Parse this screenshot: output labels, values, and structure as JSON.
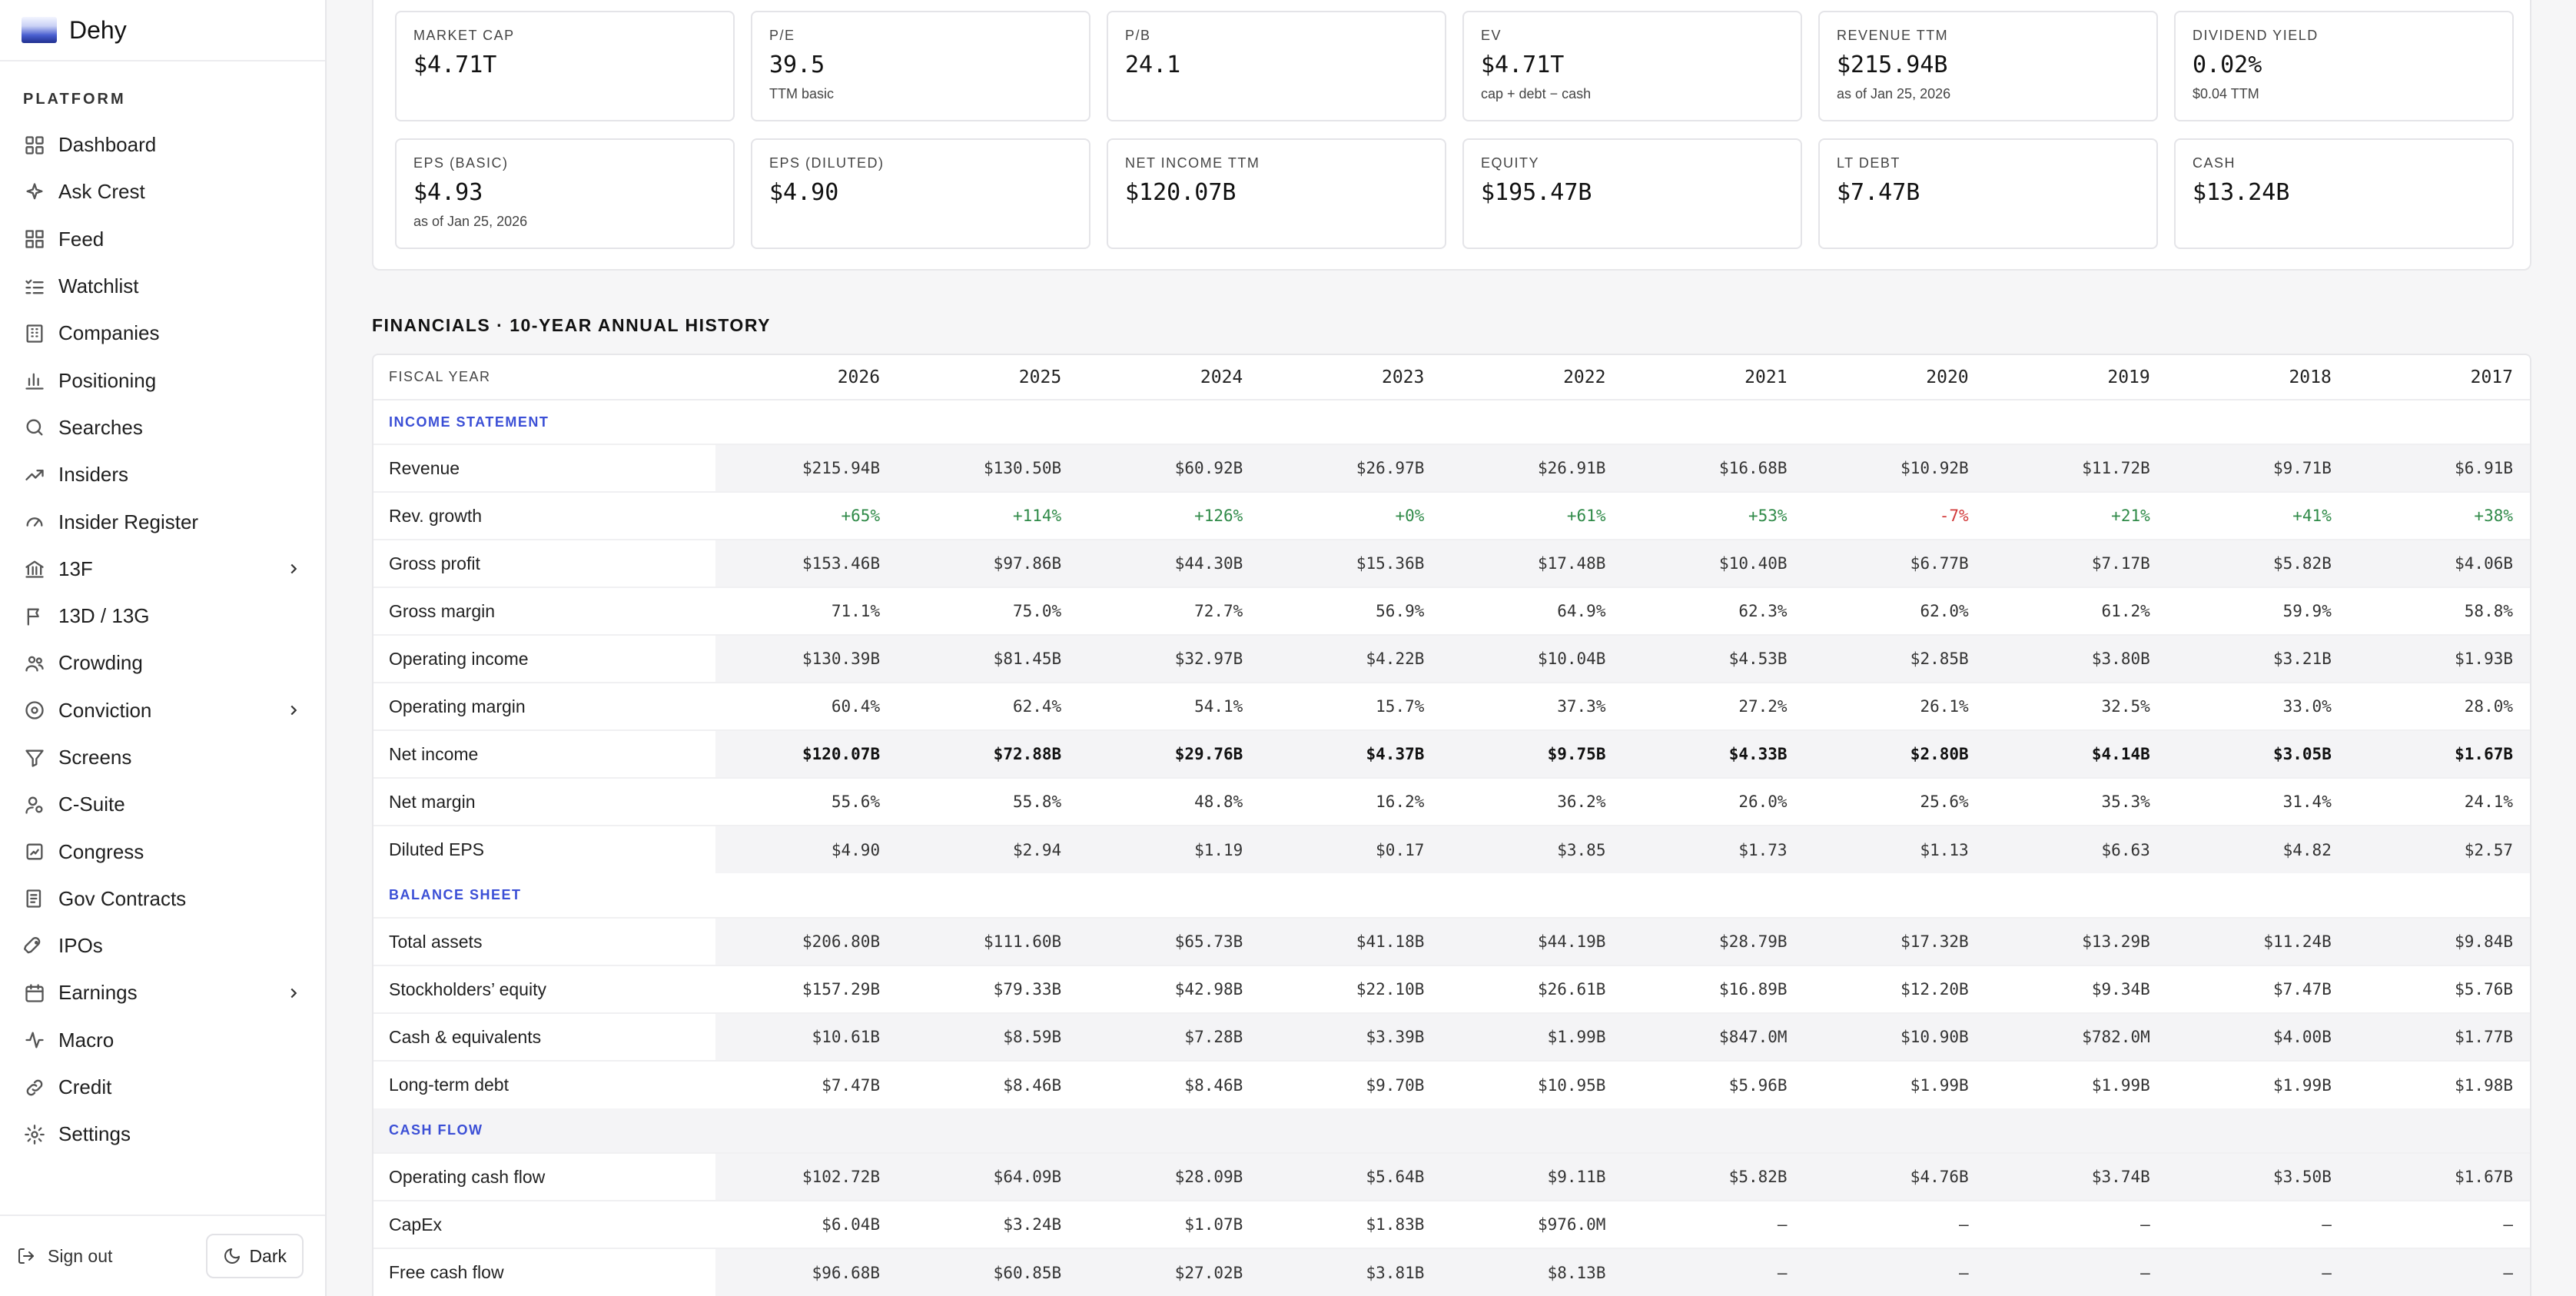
{
  "brand": {
    "name": "Dehy"
  },
  "sidebar": {
    "section_label": "PLATFORM",
    "items": [
      {
        "label": "Dashboard",
        "icon": "dashboard-icon",
        "chevron": false
      },
      {
        "label": "Ask Crest",
        "icon": "sparkle-icon",
        "chevron": false
      },
      {
        "label": "Feed",
        "icon": "grid-icon",
        "chevron": false
      },
      {
        "label": "Watchlist",
        "icon": "list-check-icon",
        "chevron": false
      },
      {
        "label": "Companies",
        "icon": "building-icon",
        "chevron": false
      },
      {
        "label": "Positioning",
        "icon": "bar-chart-icon",
        "chevron": false
      },
      {
        "label": "Searches",
        "icon": "search-icon",
        "chevron": false
      },
      {
        "label": "Insiders",
        "icon": "trending-up-icon",
        "chevron": false
      },
      {
        "label": "Insider Register",
        "icon": "gauge-icon",
        "chevron": false
      },
      {
        "label": "13F",
        "icon": "bank-icon",
        "chevron": true
      },
      {
        "label": "13D / 13G",
        "icon": "flag-icon",
        "chevron": false
      },
      {
        "label": "Crowding",
        "icon": "users-icon",
        "chevron": false
      },
      {
        "label": "Conviction",
        "icon": "target-icon",
        "chevron": true
      },
      {
        "label": "Screens",
        "icon": "filter-icon",
        "chevron": false
      },
      {
        "label": "C-Suite",
        "icon": "user-icon",
        "chevron": false
      },
      {
        "label": "Congress",
        "icon": "landmark-icon",
        "chevron": false
      },
      {
        "label": "Gov Contracts",
        "icon": "document-icon",
        "chevron": false
      },
      {
        "label": "IPOs",
        "icon": "rocket-icon",
        "chevron": false
      },
      {
        "label": "Earnings",
        "icon": "calendar-icon",
        "chevron": true
      },
      {
        "label": "Macro",
        "icon": "activity-icon",
        "chevron": false
      },
      {
        "label": "Credit",
        "icon": "link-icon",
        "chevron": false
      },
      {
        "label": "Settings",
        "icon": "gear-icon",
        "chevron": false
      }
    ],
    "sign_out": "Sign out",
    "theme_toggle": "Dark"
  },
  "stats": [
    {
      "label": "MARKET CAP",
      "value": "$4.71T",
      "sub": ""
    },
    {
      "label": "P/E",
      "value": "39.5",
      "sub": "TTM basic"
    },
    {
      "label": "P/B",
      "value": "24.1",
      "sub": ""
    },
    {
      "label": "EV",
      "value": "$4.71T",
      "sub": "cap + debt − cash"
    },
    {
      "label": "REVENUE TTM",
      "value": "$215.94B",
      "sub": "as of Jan 25, 2026"
    },
    {
      "label": "DIVIDEND YIELD",
      "value": "0.02%",
      "sub": "$0.04 TTM"
    },
    {
      "label": "EPS (BASIC)",
      "value": "$4.93",
      "sub": "as of Jan 25, 2026"
    },
    {
      "label": "EPS (DILUTED)",
      "value": "$4.90",
      "sub": ""
    },
    {
      "label": "NET INCOME TTM",
      "value": "$120.07B",
      "sub": ""
    },
    {
      "label": "EQUITY",
      "value": "$195.47B",
      "sub": ""
    },
    {
      "label": "LT DEBT",
      "value": "$7.47B",
      "sub": ""
    },
    {
      "label": "CASH",
      "value": "$13.24B",
      "sub": ""
    }
  ],
  "financials": {
    "title": "FINANCIALS · 10-YEAR ANNUAL HISTORY",
    "fiscal_year_label": "FISCAL YEAR",
    "years": [
      "2026",
      "2025",
      "2024",
      "2023",
      "2022",
      "2021",
      "2020",
      "2019",
      "2018",
      "2017"
    ],
    "sections": [
      {
        "title": "INCOME STATEMENT",
        "rows": [
          {
            "label": "Revenue",
            "style": "",
            "values": [
              "$215.94B",
              "$130.50B",
              "$60.92B",
              "$26.97B",
              "$26.91B",
              "$16.68B",
              "$10.92B",
              "$11.72B",
              "$9.71B",
              "$6.91B"
            ]
          },
          {
            "label": "Rev. growth",
            "style": "growth",
            "values": [
              "+65%",
              "+114%",
              "+126%",
              "+0%",
              "+61%",
              "+53%",
              "-7%",
              "+21%",
              "+41%",
              "+38%"
            ]
          },
          {
            "label": "Gross profit",
            "style": "",
            "values": [
              "$153.46B",
              "$97.86B",
              "$44.30B",
              "$15.36B",
              "$17.48B",
              "$10.40B",
              "$6.77B",
              "$7.17B",
              "$5.82B",
              "$4.06B"
            ]
          },
          {
            "label": "Gross margin",
            "style": "",
            "values": [
              "71.1%",
              "75.0%",
              "72.7%",
              "56.9%",
              "64.9%",
              "62.3%",
              "62.0%",
              "61.2%",
              "59.9%",
              "58.8%"
            ]
          },
          {
            "label": "Operating income",
            "style": "",
            "values": [
              "$130.39B",
              "$81.45B",
              "$32.97B",
              "$4.22B",
              "$10.04B",
              "$4.53B",
              "$2.85B",
              "$3.80B",
              "$3.21B",
              "$1.93B"
            ]
          },
          {
            "label": "Operating margin",
            "style": "",
            "values": [
              "60.4%",
              "62.4%",
              "54.1%",
              "15.7%",
              "37.3%",
              "27.2%",
              "26.1%",
              "32.5%",
              "33.0%",
              "28.0%"
            ]
          },
          {
            "label": "Net income",
            "style": "bold",
            "values": [
              "$120.07B",
              "$72.88B",
              "$29.76B",
              "$4.37B",
              "$9.75B",
              "$4.33B",
              "$2.80B",
              "$4.14B",
              "$3.05B",
              "$1.67B"
            ]
          },
          {
            "label": "Net margin",
            "style": "",
            "values": [
              "55.6%",
              "55.8%",
              "48.8%",
              "16.2%",
              "36.2%",
              "26.0%",
              "25.6%",
              "35.3%",
              "31.4%",
              "24.1%"
            ]
          },
          {
            "label": "Diluted EPS",
            "style": "",
            "values": [
              "$4.90",
              "$2.94",
              "$1.19",
              "$0.17",
              "$3.85",
              "$1.73",
              "$1.13",
              "$6.63",
              "$4.82",
              "$2.57"
            ]
          }
        ]
      },
      {
        "title": "BALANCE SHEET",
        "rows": [
          {
            "label": "Total assets",
            "style": "",
            "values": [
              "$206.80B",
              "$111.60B",
              "$65.73B",
              "$41.18B",
              "$44.19B",
              "$28.79B",
              "$17.32B",
              "$13.29B",
              "$11.24B",
              "$9.84B"
            ]
          },
          {
            "label": "Stockholders’ equity",
            "style": "",
            "values": [
              "$157.29B",
              "$79.33B",
              "$42.98B",
              "$22.10B",
              "$26.61B",
              "$16.89B",
              "$12.20B",
              "$9.34B",
              "$7.47B",
              "$5.76B"
            ]
          },
          {
            "label": "Cash & equivalents",
            "style": "",
            "values": [
              "$10.61B",
              "$8.59B",
              "$7.28B",
              "$3.39B",
              "$1.99B",
              "$847.0M",
              "$10.90B",
              "$782.0M",
              "$4.00B",
              "$1.77B"
            ]
          },
          {
            "label": "Long-term debt",
            "style": "",
            "values": [
              "$7.47B",
              "$8.46B",
              "$8.46B",
              "$9.70B",
              "$10.95B",
              "$5.96B",
              "$1.99B",
              "$1.99B",
              "$1.99B",
              "$1.98B"
            ]
          }
        ]
      },
      {
        "title": "CASH FLOW",
        "rows": [
          {
            "label": "Operating cash flow",
            "style": "",
            "values": [
              "$102.72B",
              "$64.09B",
              "$28.09B",
              "$5.64B",
              "$9.11B",
              "$5.82B",
              "$4.76B",
              "$3.74B",
              "$3.50B",
              "$1.67B"
            ]
          },
          {
            "label": "CapEx",
            "style": "",
            "values": [
              "$6.04B",
              "$3.24B",
              "$1.07B",
              "$1.83B",
              "$976.0M",
              "—",
              "—",
              "—",
              "—",
              "—"
            ]
          },
          {
            "label": "Free cash flow",
            "style": "",
            "values": [
              "$96.68B",
              "$60.85B",
              "$27.02B",
              "$3.81B",
              "$8.13B",
              "—",
              "—",
              "—",
              "—",
              "—"
            ]
          }
        ]
      }
    ]
  }
}
